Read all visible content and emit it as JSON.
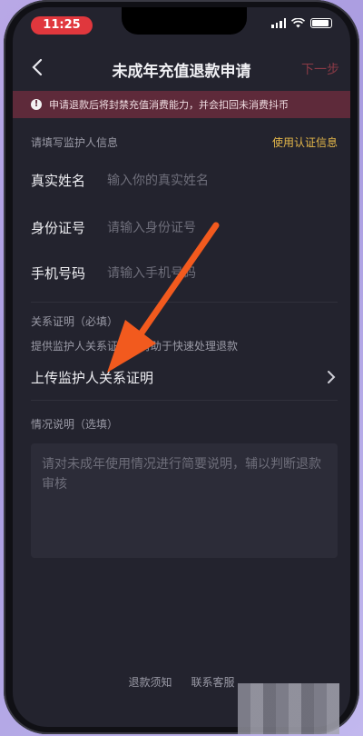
{
  "status": {
    "time": "11:25"
  },
  "nav": {
    "back_icon": "chevron-left-icon",
    "title": "未成年充值退款申请",
    "next": "下一步"
  },
  "warning": {
    "icon": "exclamation-icon",
    "text": "申请退款后将封禁充值消费能力，并会扣回未消费抖币"
  },
  "guardian": {
    "section_label": "请填写监护人信息",
    "auth_link": "使用认证信息",
    "fields": [
      {
        "label": "真实姓名",
        "placeholder": "输入你的真实姓名"
      },
      {
        "label": "身份证号",
        "placeholder": "请输入身份证号"
      },
      {
        "label": "手机号码",
        "placeholder": "请输入手机号码"
      }
    ]
  },
  "relation": {
    "title": "关系证明（必填）",
    "desc": "提供监护人关系证明，有助于快速处理退款",
    "upload_label": "上传监护人关系证明"
  },
  "situation": {
    "title": "情况说明（选填）",
    "placeholder": "请对未成年使用情况进行简要说明，辅以判断退款审核"
  },
  "footer": {
    "refund_notice": "退款须知",
    "contact": "联系客服"
  },
  "colors": {
    "accent_gold": "#e6b84a",
    "warning_bg": "#5e2a3a",
    "arrow": "#f25a1e",
    "time_pill": "#e0373d"
  }
}
